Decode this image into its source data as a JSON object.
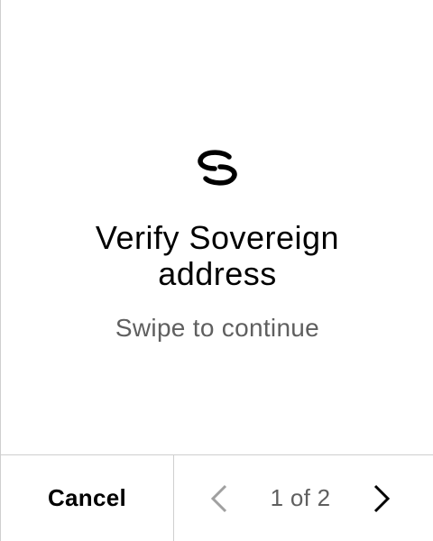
{
  "icons": {
    "logo": "sovereign-logo-icon",
    "prev": "chevron-left-icon",
    "next": "chevron-right-icon"
  },
  "main": {
    "title": "Verify Sovereign address",
    "subtitle": "Swipe to continue"
  },
  "footer": {
    "cancel_label": "Cancel",
    "page_indicator": "1 of 2",
    "current_page": 1,
    "total_pages": 2
  },
  "colors": {
    "text": "#000000",
    "muted": "#5f5f5f",
    "disabled": "#a0a0a0",
    "border": "#cfcfcf",
    "background": "#ffffff"
  }
}
